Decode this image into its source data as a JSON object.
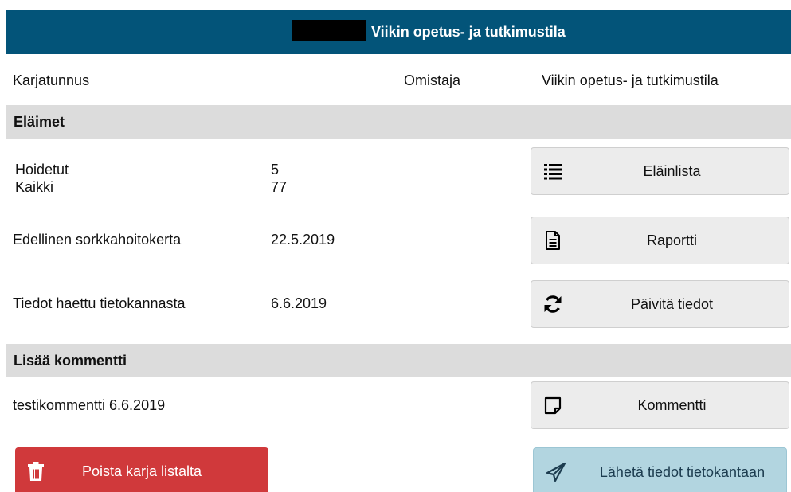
{
  "header": {
    "title": "Viikin opetus- ja tutkimustila"
  },
  "herd": {
    "id_label": "Karjatunnus",
    "owner_label": "Omistaja",
    "owner_value": "Viikin opetus- ja tutkimustila"
  },
  "animals_section": {
    "title": "Eläimet"
  },
  "stats": {
    "treated_label": "Hoidetut",
    "treated_value": "5",
    "total_label": "Kaikki",
    "total_value": "77",
    "last_trim_label": "Edellinen sorkkahoitokerta",
    "last_trim_value": "22.5.2019",
    "fetched_label": "Tiedot haettu tietokannasta",
    "fetched_value": "6.6.2019"
  },
  "buttons": {
    "animal_list": "Eläinlista",
    "report": "Raportti",
    "refresh": "Päivitä tiedot",
    "comment": "Kommentti",
    "remove_herd": "Poista karja listalta",
    "send_data": "Lähetä tiedot tietokantaan"
  },
  "comment_section": {
    "title": "Lisää kommentti",
    "text": "testikommentti 6.6.2019"
  },
  "colors": {
    "header_bg": "#035479",
    "section_bg": "#dcdcdc",
    "danger": "#d0393b",
    "primary_light": "#b2d5e0"
  },
  "icons": [
    "list-icon",
    "document-icon",
    "refresh-icon",
    "note-icon",
    "trash-icon",
    "send-icon"
  ]
}
